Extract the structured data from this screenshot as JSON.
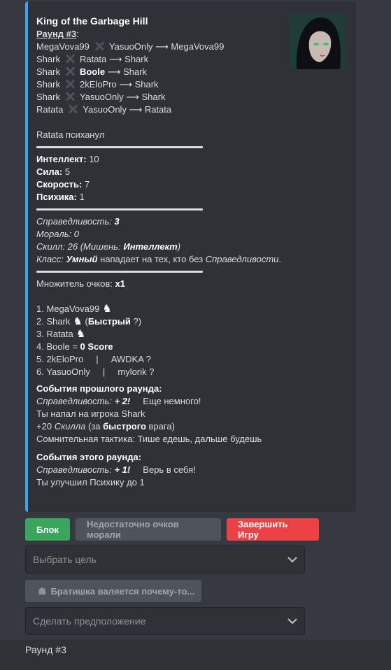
{
  "embed": {
    "title": "King of the Garbage Hill",
    "round_label": "Раунд #3",
    "fights": [
      {
        "a": "MegaVova99",
        "b": "YasuoOnly",
        "winner": "MegaVova99"
      },
      {
        "a": "Shark",
        "b": "Ratata",
        "winner": "Shark"
      },
      {
        "a": "Shark",
        "b": "Boole",
        "winner": "Shark"
      },
      {
        "a": "Shark",
        "b": "2kEloPro",
        "winner": "Shark"
      },
      {
        "a": "Shark",
        "b": "YasuoOnly",
        "winner": "Shark"
      },
      {
        "a": "Ratata",
        "b": "YasuoOnly",
        "winner": "Ratata"
      }
    ],
    "event_text": "Ratata психанул",
    "stats": [
      {
        "label": "Интеллект:",
        "value": "10"
      },
      {
        "label": "Сила:",
        "value": "5"
      },
      {
        "label": "Скорость:",
        "value": "7"
      },
      {
        "label": "Психика:",
        "value": "1"
      }
    ],
    "justice_label": "Справедливость:",
    "justice_value": "3",
    "morale": "Мораль: 0",
    "skill_prefix": "Скилл: 26 (Мишень: ",
    "skill_target": "Интеллект",
    "skill_suffix": ")",
    "class_label": "Класс:",
    "class_value": "Умный",
    "class_desc": "нападает на тех, кто без",
    "class_desc_em": "Справедливости",
    "multiplier_label": "Множитель очков:",
    "multiplier_value": "x1",
    "leaderboard": {
      "p1": "1. MegaVova99",
      "p2": "2. Shark",
      "p2_tag": "Быстрый",
      "p3": "3. Ratata",
      "p4": "4. Boole = ",
      "p4_score": "0 Score",
      "p5_name": "5. 2kEloPro",
      "p5_guess": "AWDKA ?",
      "p6_name": "6. YasuoOnly",
      "p6_guess": "mylorik ?"
    },
    "prev_events_title": "События прошлого раунда:",
    "prev_justice_label": "Справедливость:",
    "prev_justice_value": "+ 2!",
    "prev_justice_note": "Еще немного!",
    "prev_attack": "Ты напал на игрока Shark",
    "prev_skill_a": "+20",
    "prev_skill_em": "Скилла",
    "prev_skill_b": "(за",
    "prev_skill_bold": "быстрого",
    "prev_skill_c": "врага)",
    "prev_tactic": "Сомнительная тактика: Тише едешь, дальше будешь",
    "cur_events_title": "События этого раунда:",
    "cur_justice_label": "Справедливость:",
    "cur_justice_value": "+ 1!",
    "cur_justice_note": "Верь в себя!",
    "cur_upgrade": "Ты улучшил Психику до 1"
  },
  "buttons": {
    "block": "Блок",
    "not_enough_morale": "Недостаточно очков морали",
    "end_game": "Завершить Игру"
  },
  "select_target_placeholder": "Выбрать цель",
  "bro_button": "Братишка валяется почему-то...",
  "guess_placeholder": "Сделать предположение",
  "footer_text": "Раунд #3",
  "colors": {
    "accent": "#3ba5f0",
    "green": "#3ba55d",
    "red": "#ed4245",
    "gray": "#4f545c"
  }
}
